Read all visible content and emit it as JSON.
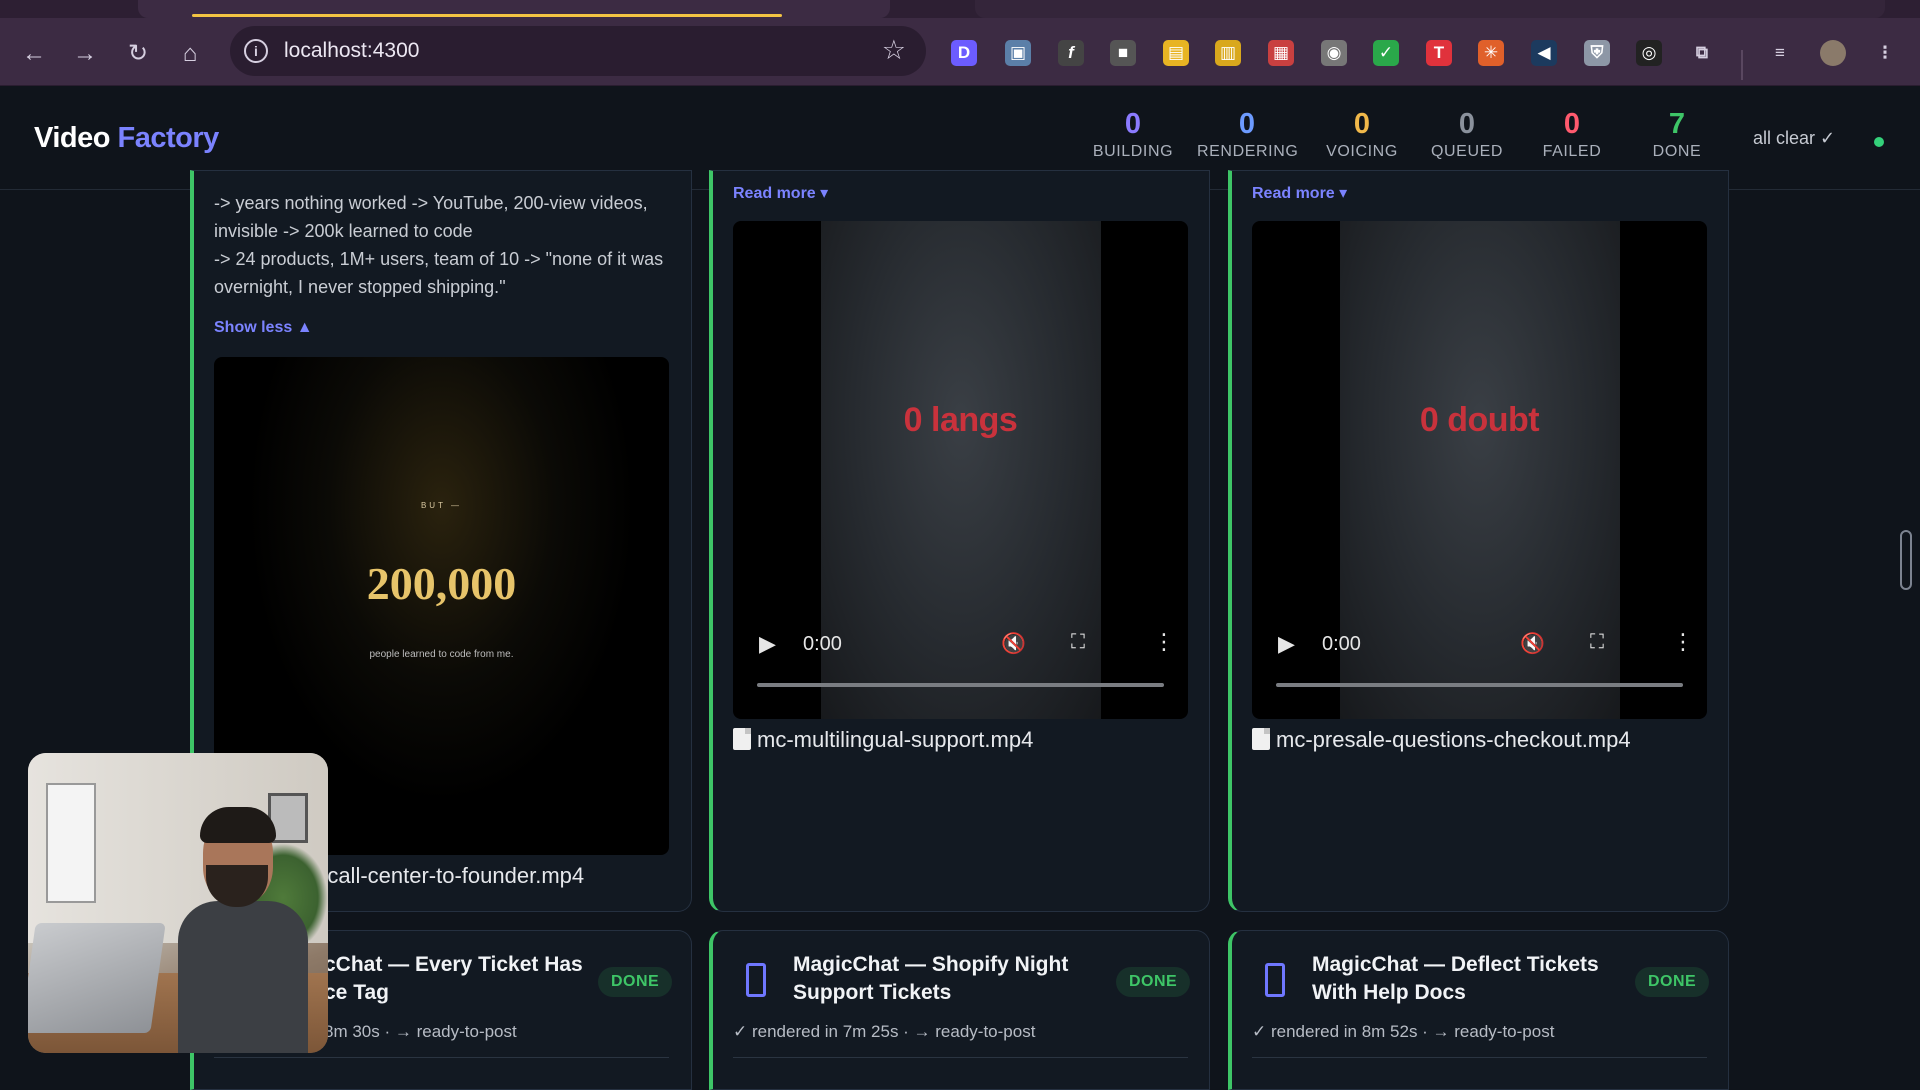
{
  "browser": {
    "url": "localhost:4300",
    "nav": {
      "back_icon": "arrow-left-icon",
      "forward_icon": "arrow-right-icon",
      "reload_icon": "reload-icon",
      "home_icon": "home-icon"
    }
  },
  "app": {
    "brand_part1": "Video",
    "brand_part2": "Factory",
    "stats": [
      {
        "value": "0",
        "label": "BUILDING",
        "color": "#8b7bff"
      },
      {
        "value": "0",
        "label": "RENDERING",
        "color": "#6d9bff"
      },
      {
        "value": "0",
        "label": "VOICING",
        "color": "#f0b84a"
      },
      {
        "value": "0",
        "label": "QUEUED",
        "color": "#8a919c"
      },
      {
        "value": "0",
        "label": "FAILED",
        "color": "#ff5a6e"
      },
      {
        "value": "7",
        "label": "DONE",
        "color": "#3ec567"
      }
    ],
    "status_text": "all clear ✓"
  },
  "cards": [
    {
      "text_lines": [
        "-> years nothing worked -> YouTube, 200-view videos,",
        "invisible -> 200k learned to code",
        "-> 24 products, 1M+ users, team of 10 -> \"none of it was",
        "overnight, I never stopped shipping.\""
      ],
      "toggle": "Show less ▲",
      "video": {
        "kicker": "BUT —",
        "big": "200,000",
        "sub": "people learned to code from me."
      },
      "filename": "-call-center-to-founder.mp4"
    },
    {
      "toggle": "Read more ▾",
      "video": {
        "overlay": "0 langs",
        "time": "0:00"
      },
      "filename": "mc-multilingual-support.mp4"
    },
    {
      "toggle": "Read more ▾",
      "video": {
        "overlay": "0 doubt",
        "time": "0:00"
      },
      "filename": "mc-presale-questions-checkout.mp4"
    }
  ],
  "jobs": [
    {
      "title_line1": "cChat — Every Ticket Has",
      "title_line2": "ce Tag",
      "badge": "DONE",
      "meta": "8m 30s · → ready-to-post"
    },
    {
      "title_line1": "MagicChat — Shopify Night",
      "title_line2": "Support Tickets",
      "badge": "DONE",
      "meta": "✓ rendered in 7m 25s · → ready-to-post"
    },
    {
      "title_line1": "MagicChat — Deflect Tickets",
      "title_line2": "With Help Docs",
      "badge": "DONE",
      "meta": "✓ rendered in 8m 52s · → ready-to-post"
    }
  ]
}
